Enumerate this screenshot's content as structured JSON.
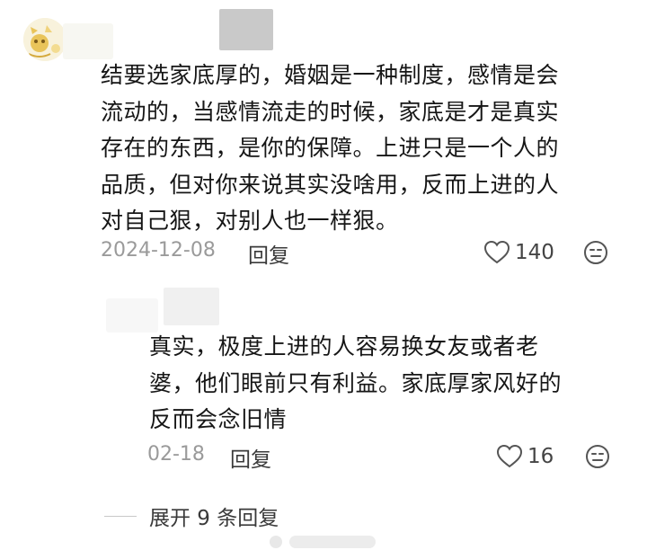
{
  "comment": {
    "text": "结要选家底厚的，婚姻是一种制度，感情是会\n流动的，当感情流走的时候，家底是才是真实\n存在的东西，是你的保障。上进只是一个人的\n品质，但对你来说其实没啥用，反而上进的人\n对自己狠，对别人也一样狠。",
    "date": "2024-12-08",
    "reply_label": "回复",
    "like_count": "140"
  },
  "reply": {
    "text": "真实，极度上进的人容易换女友或者老\n婆，他们眼前只有利益。家底厚家风好的\n反而会念旧情",
    "date": "02-18",
    "reply_label": "回复",
    "like_count": "16"
  },
  "expand": {
    "label": "展开 9 条回复"
  },
  "colors": {
    "text": "#161616",
    "meta": "#9a9a9a",
    "action": "#3a3a3a",
    "avatar_accent": "#e9c45a"
  },
  "icons": [
    "avatar",
    "heart-icon",
    "dislike-face-icon"
  ]
}
